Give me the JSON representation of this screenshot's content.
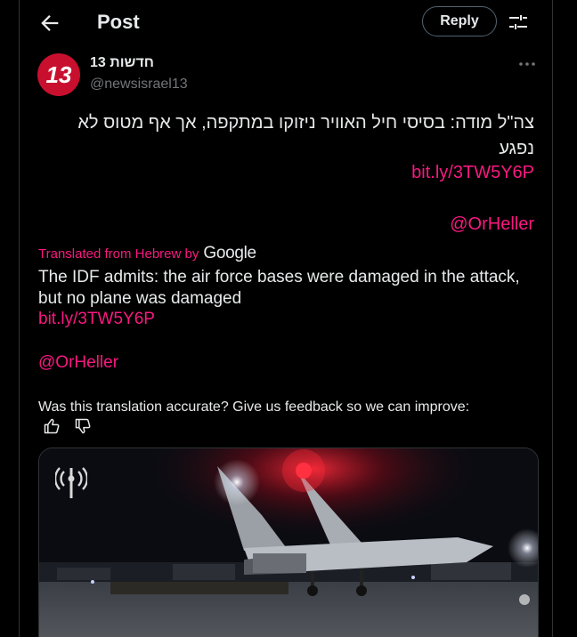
{
  "header": {
    "title": "Post",
    "reply_label": "Reply"
  },
  "author": {
    "display_name": "חדשות 13",
    "handle": "@newsisrael13",
    "avatar_text": "13"
  },
  "post": {
    "hebrew_text": "צה\"ל מודה: בסיסי חיל האוויר ניזוקו במתקפה, אך אף מטוס לא נפגע",
    "hebrew_link": "bit.ly/3TW5Y6P",
    "hebrew_mention": "@OrHeller"
  },
  "translation": {
    "label": "Translated from Hebrew by",
    "provider": "Google",
    "text": "The IDF admits: the air force bases were damaged in the attack, but no plane was damaged",
    "link": "bit.ly/3TW5Y6P",
    "mention": "@OrHeller",
    "feedback_question": "Was this translation accurate? Give us feedback so we can improve:"
  },
  "icons": {
    "back": "arrow-left-icon",
    "settings": "sliders-icon",
    "more": "more-horizontal-icon",
    "thumb_up": "thumbs-up-icon",
    "thumb_down": "thumbs-down-icon"
  },
  "colors": {
    "background": "#000000",
    "text": "#e7e9ea",
    "secondary": "#71767b",
    "accent_link": "#f91880",
    "border": "#2f3336",
    "avatar_bg": "#c8102e"
  }
}
